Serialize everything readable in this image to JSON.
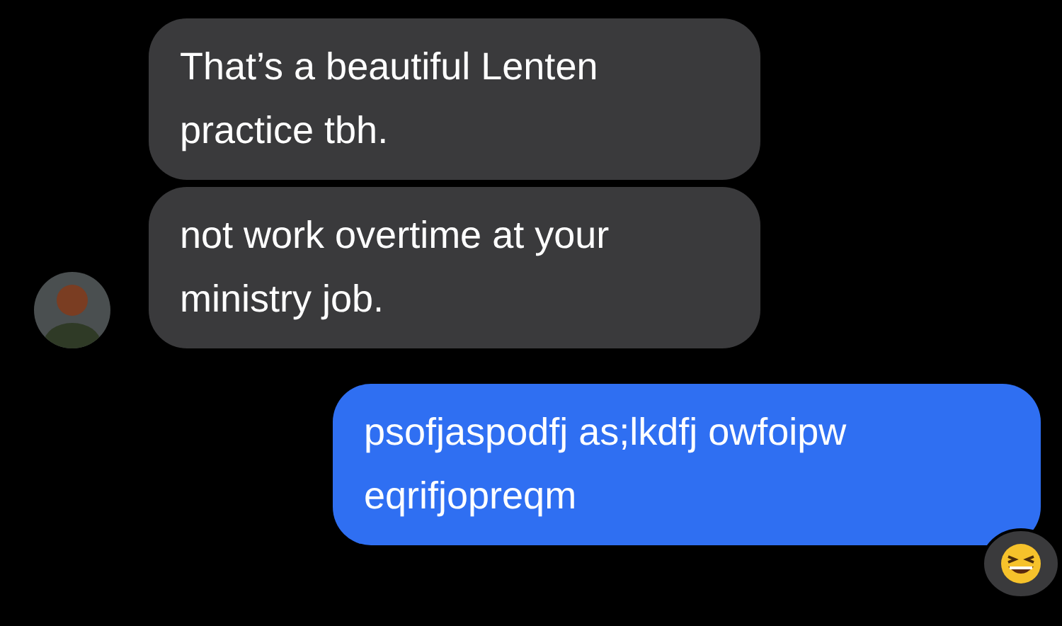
{
  "messages": [
    {
      "kind": "incoming",
      "text": "That’s a beautiful Lenten practice tbh.",
      "avatar": false
    },
    {
      "kind": "incoming",
      "text": "not work overtime at your ministry job.",
      "avatar": true
    },
    {
      "kind": "outgoing",
      "text": "psofjaspodfj as;lkdfj owfoipw eqrifjopreqm",
      "reaction": true
    }
  ]
}
